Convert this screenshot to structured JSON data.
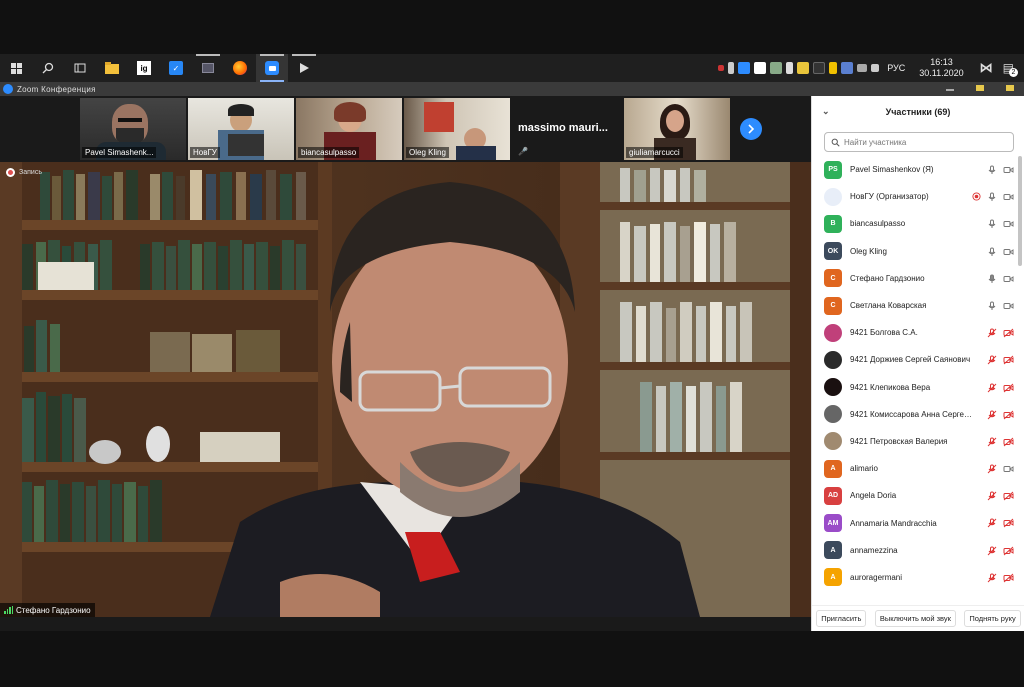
{
  "taskbar": {
    "apps": [
      "start",
      "search",
      "taskview",
      "files",
      "ig",
      "vk",
      "screen",
      "firefox",
      "zoom",
      "player"
    ],
    "tray": {
      "lang": "РУС",
      "time": "16:13",
      "date": "30.11.2020",
      "notify_count": "2"
    }
  },
  "zoom": {
    "window_title": "Zoom Конференция",
    "recording_label": "Запись",
    "active_speaker": "Стефано Гардзонио",
    "thumbnails": [
      {
        "name": "Pavel Simashenk..."
      },
      {
        "name": "НовГУ"
      },
      {
        "name": "biancasulpasso"
      },
      {
        "name": "Oleg Kling"
      },
      {
        "name": "massimo   mauri..."
      },
      {
        "name": "giuliamarcucci"
      }
    ]
  },
  "participants": {
    "title": "Участники (69)",
    "search_placeholder": "Найти участника",
    "list": [
      {
        "initials": "PS",
        "color": "#2fb15a",
        "name": "Pavel Simashenkov (Я)",
        "mic": "on",
        "cam": "on"
      },
      {
        "initials": "",
        "color": "#e8eef8",
        "name": "НовГУ (Организатор)",
        "mic": "on",
        "cam": "on",
        "rec": true
      },
      {
        "initials": "B",
        "color": "#2fb15a",
        "name": "biancasulpasso",
        "mic": "on",
        "cam": "on"
      },
      {
        "initials": "OK",
        "color": "#3c4a5c",
        "name": "Oleg Kling",
        "mic": "on",
        "cam": "on"
      },
      {
        "initials": "C",
        "color": "#e0661f",
        "name": "Стефано Гардзонио",
        "mic": "active",
        "cam": "on"
      },
      {
        "initials": "C",
        "color": "#e0661f",
        "name": "Светлана Коварская",
        "mic": "on",
        "cam": "on"
      },
      {
        "initials": "",
        "color": "#c0407a",
        "name": "9421 Болгова С.А.",
        "mic": "muted",
        "cam": "off"
      },
      {
        "initials": "",
        "color": "#2a2a2a",
        "name": "9421 Доржиев Сергей Саянович",
        "mic": "muted",
        "cam": "off"
      },
      {
        "initials": "",
        "color": "#1a1010",
        "name": "9421 Клепикова Вера",
        "mic": "muted",
        "cam": "off"
      },
      {
        "initials": "",
        "color": "#666",
        "name": "9421 Комиссарова Анна Сергее...",
        "mic": "muted",
        "cam": "off"
      },
      {
        "initials": "",
        "color": "#a08a70",
        "name": "9421 Петровская Валерия",
        "mic": "muted",
        "cam": "off"
      },
      {
        "initials": "A",
        "color": "#e0661f",
        "name": "alimario",
        "mic": "muted",
        "cam": "on"
      },
      {
        "initials": "AD",
        "color": "#d84040",
        "name": "Angela Doria",
        "mic": "muted",
        "cam": "off"
      },
      {
        "initials": "AM",
        "color": "#9a4cc8",
        "name": "Annamaria Mandracchia",
        "mic": "muted",
        "cam": "off"
      },
      {
        "initials": "A",
        "color": "#3c4a5c",
        "name": "annamezzina",
        "mic": "muted",
        "cam": "off"
      },
      {
        "initials": "A",
        "color": "#f5a300",
        "name": "auroragermani",
        "mic": "muted",
        "cam": "off"
      }
    ],
    "footer": {
      "invite": "Пригласить",
      "mute_me": "Выключить мой звук",
      "raise_hand": "Поднять руку"
    }
  }
}
